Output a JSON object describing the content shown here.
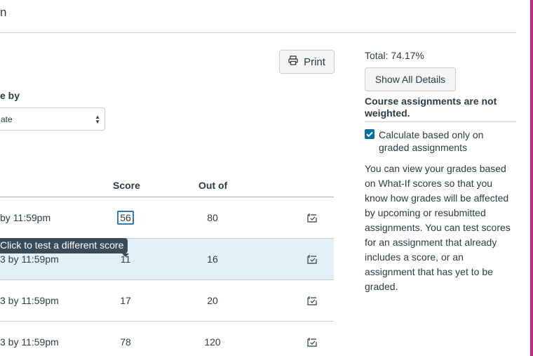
{
  "header": {
    "title_fragment": "n"
  },
  "toolbar": {
    "print_label": "Print"
  },
  "arrange": {
    "label": "e by",
    "selected": "ate"
  },
  "columns": {
    "score": "Score",
    "out_of": "Out of"
  },
  "rows": [
    {
      "due": "by 11:59pm",
      "score": "56",
      "out_of": "80"
    },
    {
      "due": "3 by 11:59pm",
      "score": "11",
      "out_of": "16"
    },
    {
      "due": "3 by 11:59pm",
      "score": "17",
      "out_of": "20"
    },
    {
      "due": "3 by 11:59pm",
      "score": "78",
      "out_of": "120"
    }
  ],
  "tooltip": "Click to test a different score",
  "sidebar": {
    "total": "Total: 74.17%",
    "show_details": "Show All Details",
    "weight_note": "Course assignments are not weighted.",
    "calc_checkbox_line1": "Calculate based only on",
    "calc_checkbox_line2": "graded assignments",
    "calc_checked": true,
    "info": "You can view your grades based on What-If scores so that you know how grades will be affected by upcoming or resubmitted assignments. You can test scores for an assignment that already includes a score, or an assignment that has yet to be graded."
  },
  "colors": {
    "accent": "#0770a3",
    "highlight_row": "#e4f0f8",
    "edge_bar": "#c2298a",
    "tooltip_bg": "#394b58"
  },
  "icons": {
    "print": "printer-icon",
    "what_if": "what-if-score-icon",
    "select_arrows": "select-arrows-icon"
  }
}
